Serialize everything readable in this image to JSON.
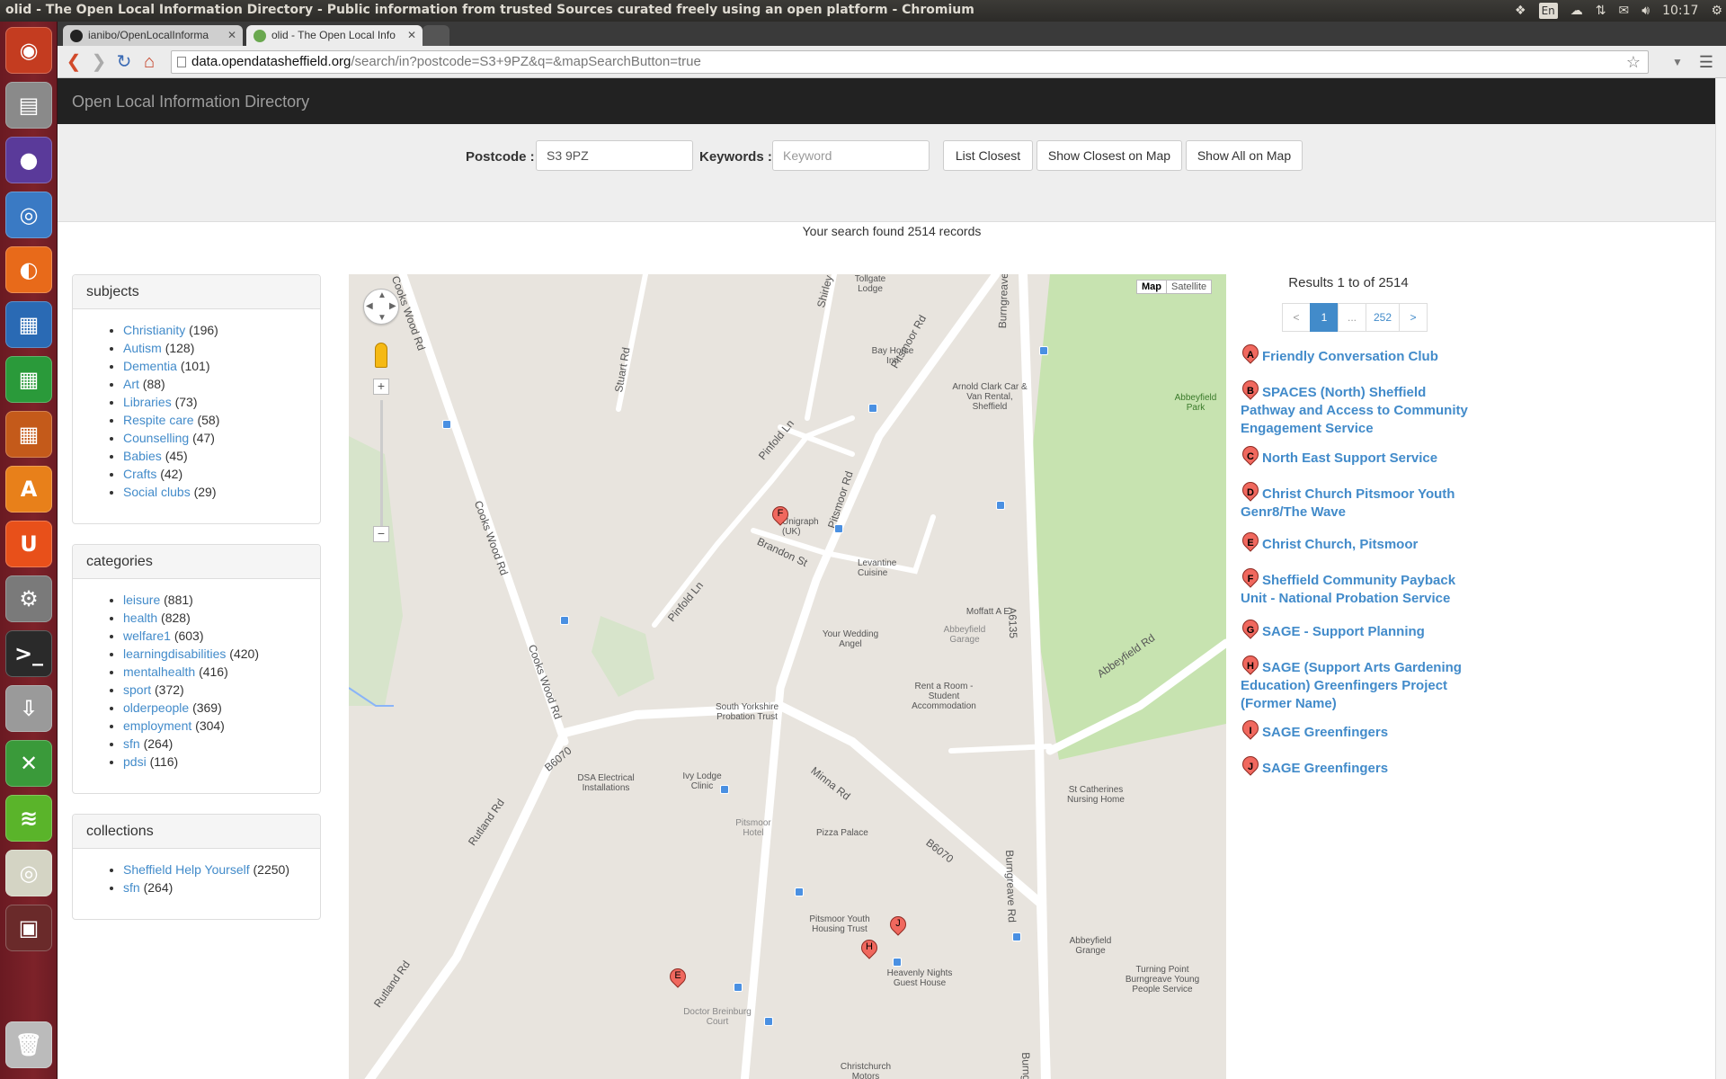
{
  "window": {
    "title": "olid - The Open Local Information Directory - Public information from trusted Sources curated freely using an open platform - Chromium",
    "clock": "10:17",
    "keyboard": "En"
  },
  "launcher": {
    "items": [
      {
        "name": "ubuntu-dash",
        "color": "#c43c20",
        "glyph": "◉"
      },
      {
        "name": "files",
        "color": "#8a8a8a",
        "glyph": "▤"
      },
      {
        "name": "eclipse",
        "color": "#5a3a9a",
        "glyph": "●"
      },
      {
        "name": "chromium",
        "color": "#3a7ac4",
        "glyph": "◎"
      },
      {
        "name": "firefox",
        "color": "#e86a1a",
        "glyph": "◐"
      },
      {
        "name": "writer",
        "color": "#2a6ab4",
        "glyph": "▦"
      },
      {
        "name": "calc",
        "color": "#2a9a3a",
        "glyph": "▦"
      },
      {
        "name": "impress",
        "color": "#c45a1a",
        "glyph": "▦"
      },
      {
        "name": "software-center",
        "color": "#e8801a",
        "glyph": "A"
      },
      {
        "name": "ubuntu-one",
        "color": "#e8501a",
        "glyph": "U"
      },
      {
        "name": "settings",
        "color": "#7a7a7a",
        "glyph": "⚙"
      },
      {
        "name": "terminal",
        "color": "#2a2a2a",
        "glyph": ">_"
      },
      {
        "name": "installer",
        "color": "#9a9a9a",
        "glyph": "⇩"
      },
      {
        "name": "xcode-tool",
        "color": "#3a9a3a",
        "glyph": "✕"
      },
      {
        "name": "spotify",
        "color": "#5ab42a",
        "glyph": "≋"
      },
      {
        "name": "speaker",
        "color": "#d4d4c4",
        "glyph": "◎"
      },
      {
        "name": "workspaces",
        "color": "#6a2a2a",
        "glyph": "▣"
      }
    ],
    "trash": "trash"
  },
  "tabs": [
    {
      "title": "ianibo/OpenLocalInforma",
      "active": false
    },
    {
      "title": "olid - The Open Local Info",
      "active": true
    }
  ],
  "address": {
    "host": "data.opendatasheffield.org",
    "path": "/search/in?postcode=S3+9PZ&q=&mapSearchButton=true"
  },
  "brand": "Open Local Information Directory",
  "search": {
    "postcode_label": "Postcode :",
    "postcode_value": "S3 9PZ",
    "keywords_label": "Keywords :",
    "keywords_placeholder": "Keyword",
    "btn_list_closest": "List Closest",
    "btn_show_closest": "Show Closest on Map",
    "btn_show_all": "Show All on Map",
    "found": "Your search found 2514 records"
  },
  "subjects": {
    "title": "subjects",
    "items": [
      {
        "label": "Christianity",
        "count": "(196)"
      },
      {
        "label": "Autism",
        "count": "(128)"
      },
      {
        "label": "Dementia",
        "count": "(101)"
      },
      {
        "label": "Art",
        "count": "(88)"
      },
      {
        "label": "Libraries",
        "count": "(73)"
      },
      {
        "label": "Respite care",
        "count": "(58)"
      },
      {
        "label": "Counselling",
        "count": "(47)"
      },
      {
        "label": "Babies",
        "count": "(45)"
      },
      {
        "label": "Crafts",
        "count": "(42)"
      },
      {
        "label": "Social clubs",
        "count": "(29)"
      }
    ]
  },
  "categories": {
    "title": "categories",
    "items": [
      {
        "label": "leisure",
        "count": "(881)"
      },
      {
        "label": "health",
        "count": "(828)"
      },
      {
        "label": "welfare1",
        "count": "(603)"
      },
      {
        "label": "learningdisabilities",
        "count": "(420)"
      },
      {
        "label": "mentalhealth",
        "count": "(416)"
      },
      {
        "label": "sport",
        "count": "(372)"
      },
      {
        "label": "olderpeople",
        "count": "(369)"
      },
      {
        "label": "employment",
        "count": "(304)"
      },
      {
        "label": "sfn",
        "count": "(264)"
      },
      {
        "label": "pdsi",
        "count": "(116)"
      }
    ]
  },
  "collections": {
    "title": "collections",
    "items": [
      {
        "label": "Sheffield Help Yourself",
        "count": "(2250)"
      },
      {
        "label": "sfn",
        "count": "(264)"
      }
    ]
  },
  "map": {
    "type_map": "Map",
    "type_satellite": "Satellite",
    "road_labels": [
      "Cooks Wood Rd",
      "Cooks Wood Rd",
      "Cooks Wood Rd",
      "Shirley Rd",
      "Pitsmoor Rd",
      "Pitsmoor Rd",
      "Burngreave Rd",
      "Burngreave Rd",
      "Burngreave Rd",
      "Pinfold Ln",
      "Pinfold Ln",
      "Brandon St",
      "Stuart Rd",
      "Minna Rd",
      "B6070",
      "B6070",
      "Rutland Rd",
      "Rutland Rd",
      "A6135",
      "Abbeyfield Rd"
    ],
    "place_labels": [
      "Tollgate Lodge",
      "Bay Horse Inn",
      "Arnold Clark Car & Van Rental, Sheffield",
      "Abbeyfield Park",
      "Unigraph (UK)",
      "Levantine Cuisine",
      "Moffatt A E",
      "Abbeyfield Garage",
      "Your Wedding Angel",
      "Rent a Room - Student Accommodation",
      "South Yorkshire Probation Trust",
      "DSA Electrical Installations",
      "Ivy Lodge Clinic",
      "Pitsmoor Hotel",
      "Pizza Palace",
      "St Catherines Nursing Home",
      "Pitsmoor Youth Housing Trust",
      "Heavenly Nights Guest House",
      "Abbeyfield Grange",
      "Turning Point Burngreave Young People Service",
      "Doctor Breinburg Court",
      "Christchurch Motors"
    ],
    "markers": [
      "F",
      "E",
      "J",
      "H"
    ]
  },
  "results": {
    "count": "Results 1 to of 2514",
    "pages": [
      "<",
      "1",
      "...",
      "252",
      ">"
    ],
    "items": [
      {
        "letter": "A",
        "title": "Friendly Conversation Club"
      },
      {
        "letter": "B",
        "title": "SPACES (North) Sheffield Pathway and Access to Community Engagement Service"
      },
      {
        "letter": "C",
        "title": "North East Support Service"
      },
      {
        "letter": "D",
        "title": "Christ Church Pitsmoor Youth Genr8/The Wave"
      },
      {
        "letter": "E",
        "title": "Christ Church, Pitsmoor"
      },
      {
        "letter": "F",
        "title": "Sheffield Community Payback Unit - National Probation Service"
      },
      {
        "letter": "G",
        "title": "SAGE - Support Planning"
      },
      {
        "letter": "H",
        "title": "SAGE (Support Arts Gardening Education) Greenfingers Project (Former Name)"
      },
      {
        "letter": "I",
        "title": "SAGE Greenfingers"
      },
      {
        "letter": "J",
        "title": "SAGE Greenfingers"
      }
    ]
  }
}
